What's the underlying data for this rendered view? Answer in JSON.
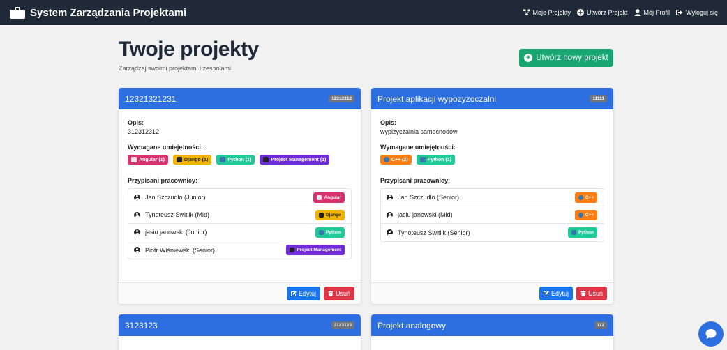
{
  "navbar": {
    "brand": "System Zarządzania Projektami",
    "links": [
      {
        "label": "Moje Projekty",
        "icon": "projects-icon"
      },
      {
        "label": "Utwórz Projekt",
        "icon": "plus-circle-icon"
      },
      {
        "label": "Mój Profil",
        "icon": "user-icon"
      },
      {
        "label": "Wyloguj się",
        "icon": "logout-icon"
      }
    ]
  },
  "header": {
    "title": "Twoje projekty",
    "subtitle": "Zarządzaj swoimi projektami i zespołami",
    "create_button": "Utwórz nowy projekt"
  },
  "labels": {
    "description": "Opis:",
    "skills": "Wymagane umiejętności:",
    "workers": "Przypisani pracownicy:",
    "edit": "Edytuj",
    "delete": "Usuń"
  },
  "colors": {
    "navbar": "#1f2937",
    "card_header": "#2d6fe0",
    "create": "#17a673",
    "edit": "#1a73e8",
    "delete": "#dc3545",
    "angular": "#d6336c",
    "django": "#f0b400",
    "python": "#20c997",
    "pm": "#6f2cd6",
    "cpp": "#fd7e14"
  },
  "projects": [
    {
      "title": "12321321231",
      "id": "12312312",
      "description": "312312312",
      "skills": [
        {
          "label": "Angular (1)",
          "kind": "angular"
        },
        {
          "label": "Django (1)",
          "kind": "django"
        },
        {
          "label": "Python (1)",
          "kind": "python"
        },
        {
          "label": "Project Management (1)",
          "kind": "pm"
        }
      ],
      "workers": [
        {
          "name": "Jan Szczudlo (Junior)",
          "skill": "Angular",
          "kind": "angular"
        },
        {
          "name": "Tynoteusz Switlik (Mid)",
          "skill": "Django",
          "kind": "django"
        },
        {
          "name": "jasiu janowski (Junior)",
          "skill": "Python",
          "kind": "python"
        },
        {
          "name": "Piotr Wiśniewski (Senior)",
          "skill": "Project Management",
          "kind": "pm"
        }
      ]
    },
    {
      "title": "Projekt aplikacji wypozyzoczalni",
      "id": "11111",
      "description": "wypizyczalnia samochodow",
      "skills": [
        {
          "label": "C++ (2)",
          "kind": "cpp"
        },
        {
          "label": "Python (1)",
          "kind": "python"
        }
      ],
      "workers": [
        {
          "name": "Jan Szczudlo (Senior)",
          "skill": "C++",
          "kind": "cpp"
        },
        {
          "name": "jasiu janowski (Mid)",
          "skill": "C++",
          "kind": "cpp"
        },
        {
          "name": "Tynoteusz Switlik (Senior)",
          "skill": "Python",
          "kind": "python"
        }
      ]
    },
    {
      "title": "3123123",
      "id": "3123123"
    },
    {
      "title": "Projekt analogowy",
      "id": "112"
    }
  ]
}
